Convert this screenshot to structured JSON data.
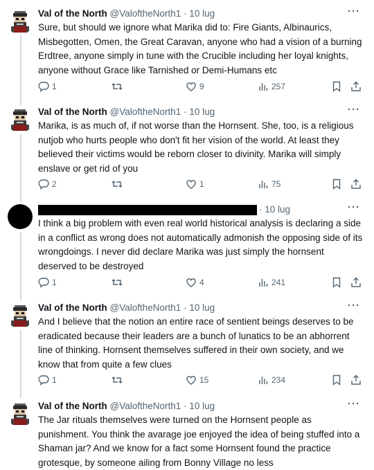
{
  "tweets": [
    {
      "name": "Val of the North",
      "handle": "@ValoftheNorth1",
      "time": "· 10 lug",
      "text": "Sure, but should we ignore what Marika did to: Fire Giants, Albinaurics, Misbegotten, Omen, the Great Caravan, anyone who had a vision of a burning Erdtree, anyone simply in tune with the Crucible including her loyal knights, anyone without Grace like Tarnished or Demi-Humans etc",
      "replies": "1",
      "retweets": "",
      "likes": "9",
      "views": "257"
    },
    {
      "name": "Val of the North",
      "handle": "@ValoftheNorth1",
      "time": "· 10 lug",
      "text": "Marika, is as much of, if not worse than the Hornsent. She, too, is a religious nutjob who hurts people who don't fit her vision of the world. At least they believed their victims would be reborn closer to divinity. Marika will simply enslave or get rid of you",
      "replies": "2",
      "retweets": "",
      "likes": "1",
      "views": "75"
    },
    {
      "time": "· 10 lug",
      "text": "I think a big problem with even real world historical analysis is declaring a side in a conflict as wrong does not automatically admonish the opposing side of its wrongdoings. I never did declare Marika was just simply the hornsent deserved to be destroyed",
      "replies": "1",
      "retweets": "",
      "likes": "4",
      "views": "241"
    },
    {
      "name": "Val of the North",
      "handle": "@ValoftheNorth1",
      "time": "· 10 lug",
      "text": "And I believe that the notion an entire race of sentient beings deserves to be eradicated because their leaders are a bunch of lunatics to be an abhorrent line of thinking. Hornsent themselves suffered in their own society, and we know that from quite a few clues",
      "replies": "1",
      "retweets": "",
      "likes": "15",
      "views": "234"
    },
    {
      "name": "Val of the North",
      "handle": "@ValoftheNorth1",
      "time": "· 10 lug",
      "text": "The Jar rituals themselves were turned on the Hornsent people as punishment. You think the avarage joe enjoyed the idea of being stuffed into a Shaman jar? And we know for a fact some Hornsent found the practice grotesque, by someone ailing from Bonny Village no less"
    }
  ],
  "more_label": "···"
}
